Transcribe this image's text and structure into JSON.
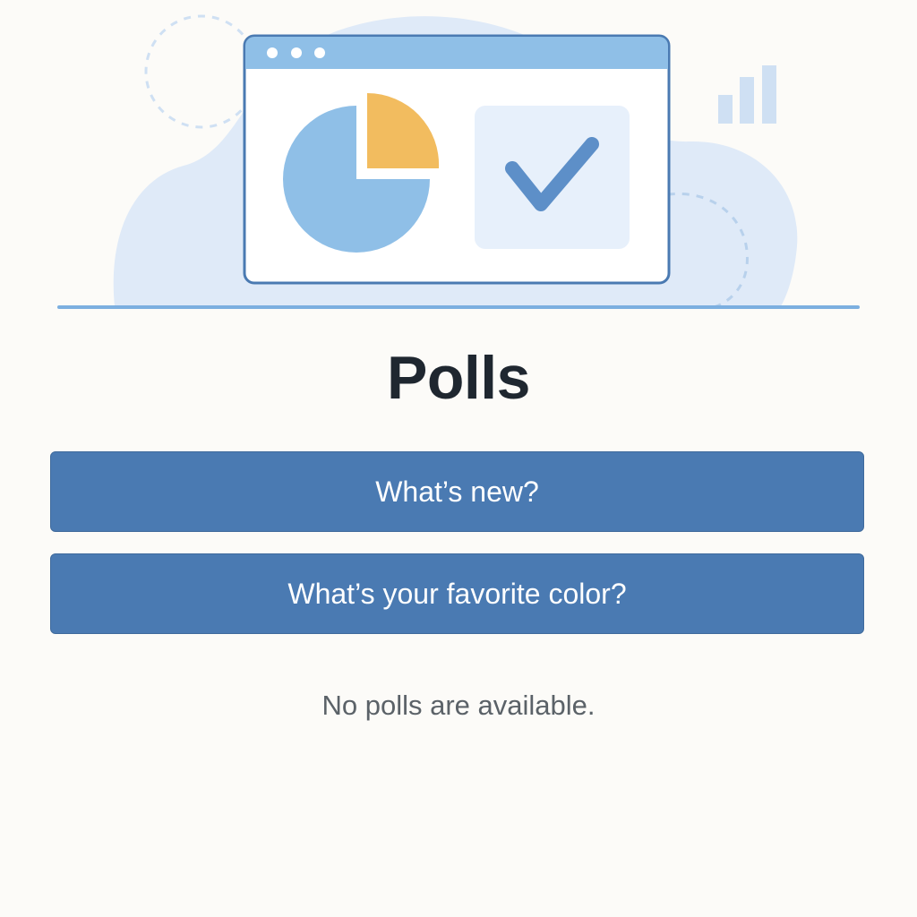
{
  "page": {
    "title": "Polls",
    "empty_message": "No polls are available."
  },
  "polls": [
    {
      "label": "What’s new?"
    },
    {
      "label": "What’s your favorite color?"
    }
  ],
  "colors": {
    "background": "#fcfbf8",
    "button": "#4a7ab2",
    "title": "#1f2730",
    "illustration_blue": "#8fbfe7",
    "illustration_orange": "#f2bc5f",
    "illustration_light": "#dfeaf8"
  },
  "icons": {
    "pie": "pie-chart-icon",
    "check": "checkmark-icon",
    "bars": "bar-chart-icon"
  }
}
